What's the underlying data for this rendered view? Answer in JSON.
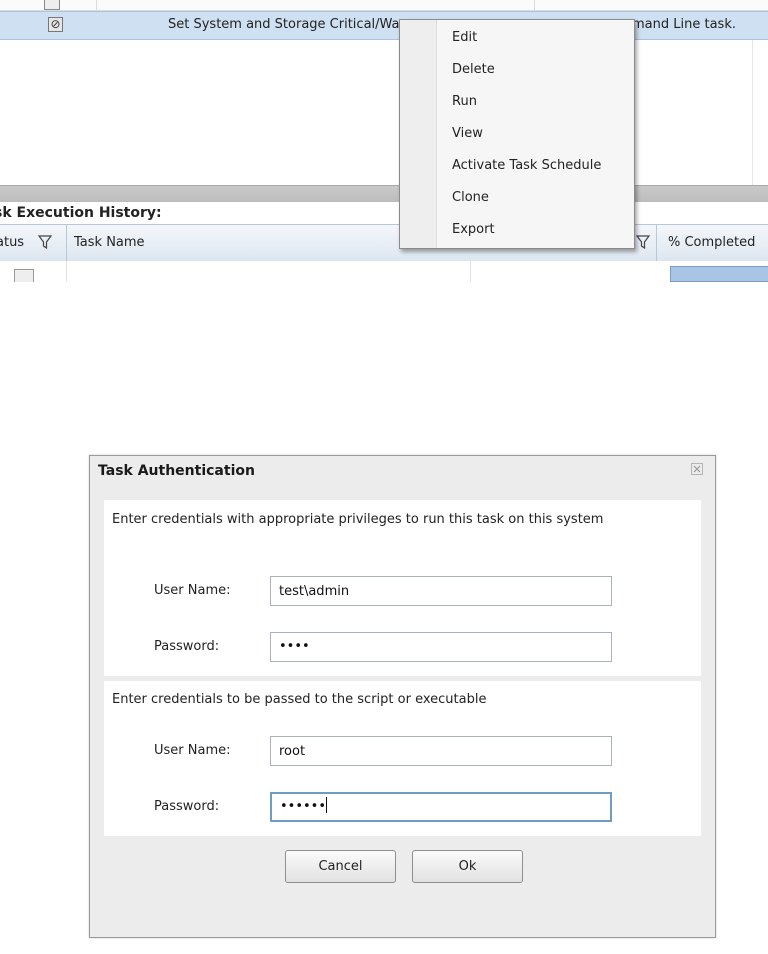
{
  "task_grid": {
    "selected_row": {
      "task_name": "Set System and Storage Critical/Wa",
      "description_tail": "mand Line task."
    }
  },
  "context_menu": {
    "items": [
      {
        "label": "Edit"
      },
      {
        "label": "Delete"
      },
      {
        "label": "Run"
      },
      {
        "label": "View"
      },
      {
        "label": "Activate Task Schedule"
      },
      {
        "label": "Clone"
      },
      {
        "label": "Export"
      }
    ]
  },
  "execution_history": {
    "title": "sk Execution History:",
    "columns": {
      "status": "atus",
      "task_name": "Task Name",
      "percent_completed": "% Completed"
    }
  },
  "dialog": {
    "title": "Task Authentication",
    "section1": {
      "message": "Enter credentials with appropriate privileges to run this task on this system",
      "username_label": "User Name:",
      "username_value": "test\\admin",
      "password_label": "Password:",
      "password_value": "••••"
    },
    "section2": {
      "message": "Enter credentials to be passed to the script or executable",
      "username_label": "User Name:",
      "username_value": "root",
      "password_label": "Password:",
      "password_value": "••••••"
    },
    "buttons": {
      "cancel": "Cancel",
      "ok": "Ok"
    }
  },
  "colors": {
    "selected_row": "#cfe0f3",
    "dialog_bg": "#ececec",
    "focus_border": "#6e9dc4"
  },
  "icons": {
    "row_status": "stop-icon",
    "filter": "filter-icon",
    "close": "close-icon"
  }
}
